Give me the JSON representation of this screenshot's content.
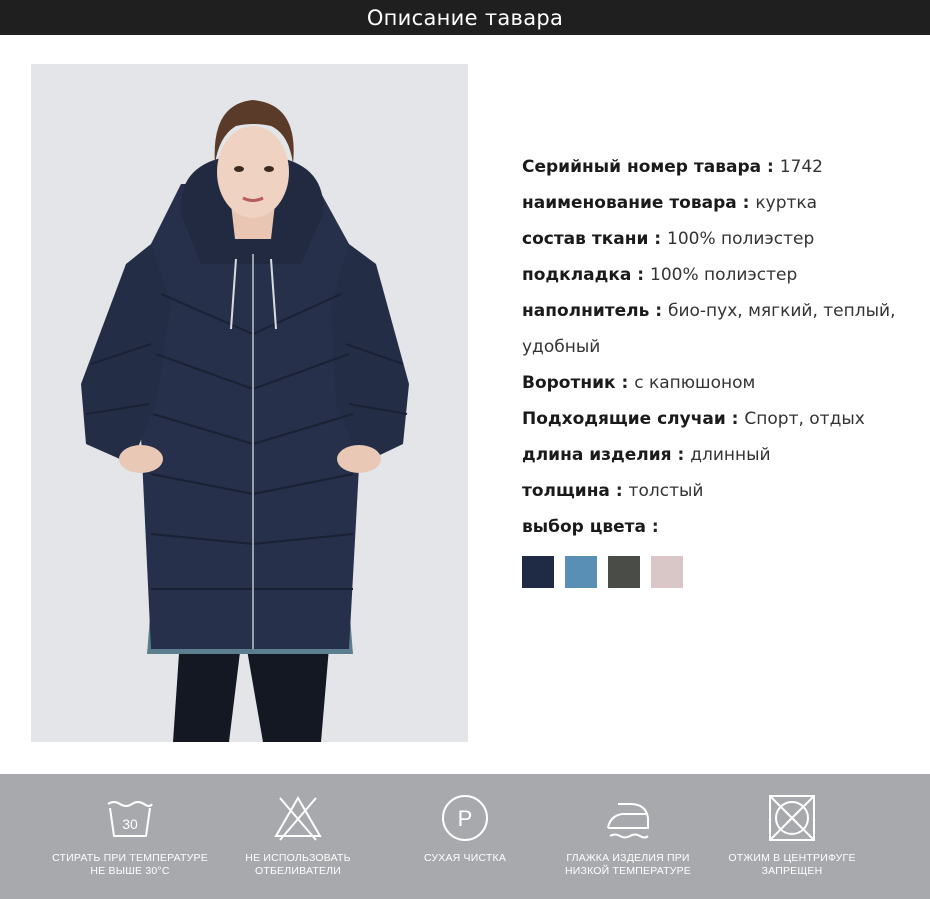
{
  "header": {
    "title": "Описание тавара"
  },
  "specs": [
    {
      "key": "Серийный номер тавара",
      "value": "1742"
    },
    {
      "key": "наименование товара",
      "value": "куртка"
    },
    {
      "key": "состав ткани",
      "value": "100% полиэстер"
    },
    {
      "key": "подкладка",
      "value": "100% полиэстер"
    },
    {
      "key": "наполнитель",
      "value": "био-пух, мягкий, теплый, удобный"
    },
    {
      "key": "Воротник",
      "value": "с капюшоном"
    },
    {
      "key": "Подходящие случаи",
      "value": "Спорт, отдых"
    },
    {
      "key": "длина изделия",
      "value": "длинный"
    },
    {
      "key": "толщина",
      "value": "толстый"
    },
    {
      "key": "выбор цвета",
      "value": ""
    }
  ],
  "separator": " : ",
  "colors": [
    "#1f2a44",
    "#5a8fb5",
    "#4a4d47",
    "#d9c7c7"
  ],
  "care": [
    {
      "icon": "wash-30-icon",
      "line1": "СТИРАТЬ ПРИ ТЕМПЕРАТУРЕ",
      "line2": "НЕ ВЫШЕ 30°С",
      "temp": "30"
    },
    {
      "icon": "no-bleach-icon",
      "line1": "НЕ ИСПОЛЬЗОВАТЬ",
      "line2": "ОТБЕЛИВАТЕЛИ"
    },
    {
      "icon": "dry-clean-icon",
      "line1": "СУХАЯ ЧИСТКА",
      "line2": "",
      "letter": "P"
    },
    {
      "icon": "iron-low-icon",
      "line1": "ГЛАЖКА ИЗДЕЛИЯ ПРИ",
      "line2": "НИЗКОЙ ТЕМПЕРАТУРЕ"
    },
    {
      "icon": "no-tumble-dry-icon",
      "line1": "ОТЖИМ В ЦЕНТРИФУГЕ",
      "line2": "ЗАПРЕЩЕН"
    }
  ]
}
